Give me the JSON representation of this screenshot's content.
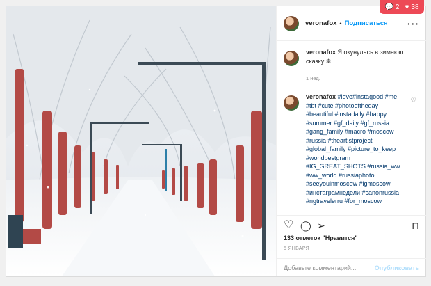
{
  "notifications": {
    "comment_count": "2",
    "like_count": "38"
  },
  "post": {
    "author": "veronafox",
    "separator": "•",
    "follow_label": "Подписаться",
    "more_icon": "more-options-icon",
    "caption": {
      "author": "veronafox",
      "text": "Я окунулась в зимнюю сказку ❄",
      "time": "1 нед."
    },
    "comment": {
      "author": "veronafox",
      "text": "#love#instagood #me #tbt #cute #photooftheday #beautiful #instadaily #happy #summer #gf_daily #gf_russia #gang_family #macro #moscow #russia #theartistproject #global_family #picture_to_keep #worldbestgram #IG_GREAT_SHOTS #russia_ww #ww_world #russiaphoto #seeyouinmoscow #igmoscow #инстаграмнедели #canonrussia #ngtravelerru #for_moscow"
    },
    "likes": "133 отметок \"Нравится\"",
    "date": "5 ЯНВАРЯ",
    "add_comment_placeholder": "Добавьте комментарий...",
    "publish_label": "Опубликовать",
    "colors": {
      "accent": "#0095f6",
      "badge": "#ed4956",
      "tags": "#00376b"
    }
  }
}
